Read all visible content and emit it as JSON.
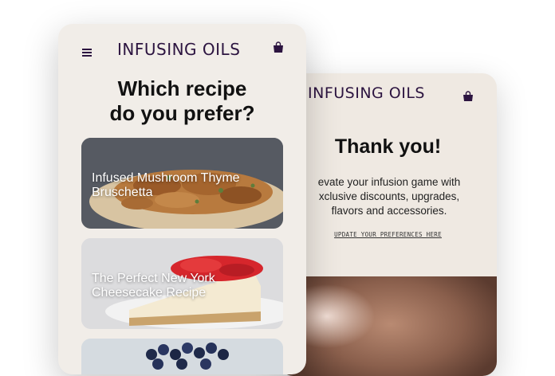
{
  "brand": {
    "name": "INFUSING OILS"
  },
  "icons": {
    "menu": "hamburger-menu-icon",
    "cart": "shopping-bag-icon"
  },
  "colors": {
    "brand": "#2c1440",
    "screen_bg": "#f1ede8"
  },
  "quiz_screen": {
    "question": "Which recipe\ndo you prefer?",
    "options": [
      {
        "label": "Infused Mushroom Thyme Bruschetta"
      },
      {
        "label": "The Perfect New York Cheesecake Recipe"
      },
      {
        "label": ""
      }
    ]
  },
  "thanks_screen": {
    "heading": "Thank you!",
    "body": "evate your infusion game with\nxclusive discounts, upgrades,\nflavors and accessories.",
    "link": "UPDATE YOUR PREFERENCES HERE"
  }
}
